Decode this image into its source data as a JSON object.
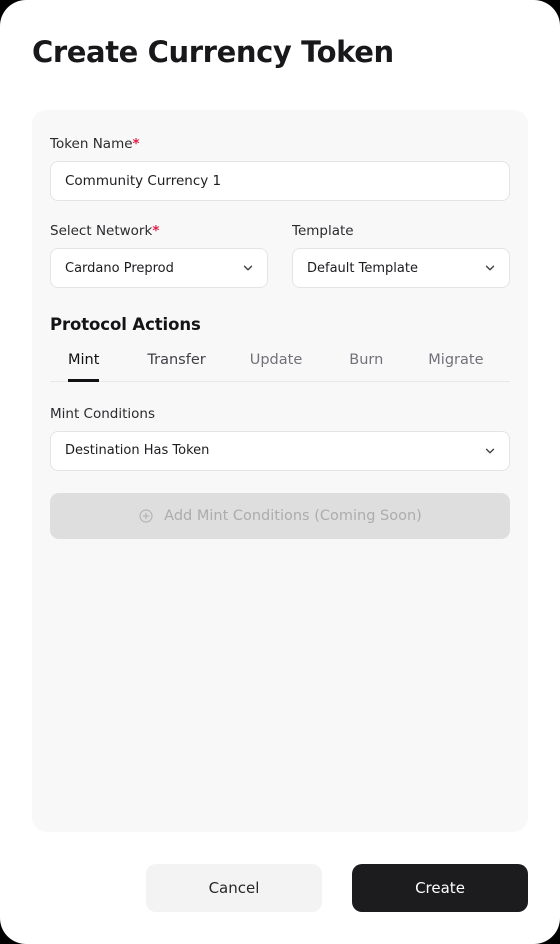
{
  "page": {
    "title": "Create Currency Token"
  },
  "form": {
    "token_name": {
      "label": "Token Name",
      "required_marker": "*",
      "value": "Community Currency 1",
      "placeholder": "Token Name"
    },
    "network": {
      "label": "Select Network",
      "required_marker": "*",
      "value": "Cardano Preprod"
    },
    "template": {
      "label": "Template",
      "value": "Default Template"
    }
  },
  "protocol_actions": {
    "heading": "Protocol Actions",
    "tabs": [
      {
        "label": "Mint",
        "state": "active"
      },
      {
        "label": "Transfer",
        "state": "inactive-dark"
      },
      {
        "label": "Update",
        "state": "inactive"
      },
      {
        "label": "Burn",
        "state": "inactive"
      },
      {
        "label": "Migrate",
        "state": "inactive"
      }
    ],
    "active_tab": "Mint"
  },
  "mint_conditions": {
    "label": "Mint Conditions",
    "value": "Destination Has Token",
    "add_button": {
      "label": "Add Mint Conditions (Coming Soon)",
      "icon": "plus-circle-icon",
      "disabled": true
    }
  },
  "footer": {
    "cancel_label": "Cancel",
    "create_label": "Create"
  },
  "icons": {
    "chevron_down": "chevron-down-icon",
    "plus_circle": "plus-circle-icon"
  },
  "colors": {
    "accent_required": "#e11d48",
    "primary_button_bg": "#1c1c1e",
    "card_bg": "#f8f8f8",
    "page_bg": "#ffffff",
    "tab_active": "#111114",
    "tab_inactive": "#71717a",
    "disabled_button_bg": "#dedede"
  }
}
